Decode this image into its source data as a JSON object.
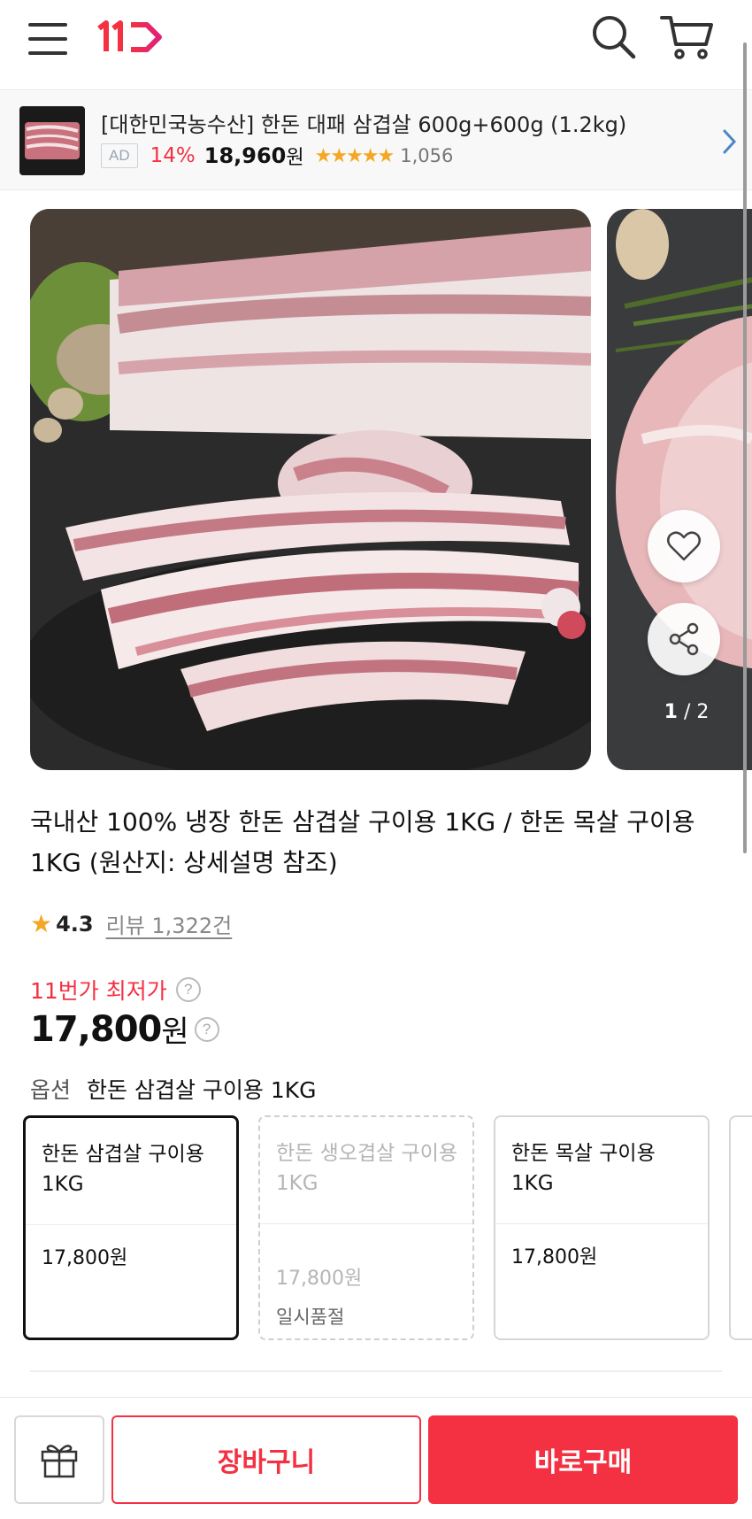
{
  "header": {
    "logo_text": "11",
    "brand_color": "#f43142",
    "icons": [
      "menu-icon",
      "search-icon",
      "cart-icon"
    ]
  },
  "ad_banner": {
    "title": "[대한민국농수산] 한돈 대패 삼겹살 600g+600g (1.2kg)",
    "badge": "AD",
    "discount": "14%",
    "price": "18,960",
    "currency": "원",
    "stars": "★★★★★",
    "rating": 4.5,
    "review_count": "1,056"
  },
  "gallery": {
    "counter_current": "1",
    "counter_total": "2"
  },
  "product": {
    "title": "국내산 100% 냉장 한돈 삼겹살 구이용 1KG / 한돈 목살 구이용 1KG (원산지: 상세설명 참조)",
    "rating_star": "★",
    "rating_score": "4.3",
    "review_text": "리뷰 1,322건",
    "best_price_label": "11번가 최저가",
    "help_glyph": "?",
    "price": "17,800",
    "currency": "원"
  },
  "options": {
    "label": "옵션",
    "selected": "한돈 삼겹살 구이용 1KG",
    "cards": [
      {
        "name": "한돈 삼겹살 구이용 1KG",
        "price": "17,800원",
        "status": ""
      },
      {
        "name": "한돈 생오겹살 구이용 1KG",
        "price": "17,800원",
        "status": "일시품절"
      },
      {
        "name": "한돈 목살 구이용 1KG",
        "price": "17,800원",
        "status": ""
      }
    ]
  },
  "bottom_bar": {
    "cart_label": "장바구니",
    "buy_label": "바로구매"
  },
  "colors": {
    "accent": "#f43142",
    "star": "#f5a623"
  }
}
